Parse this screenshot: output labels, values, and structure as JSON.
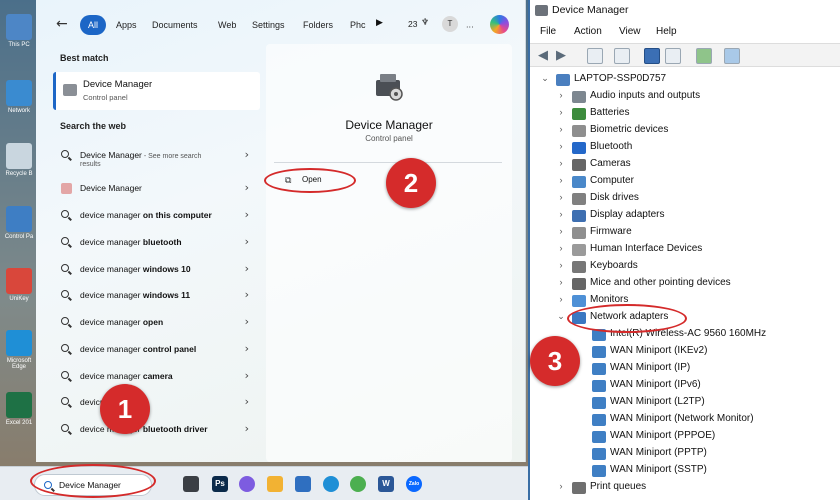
{
  "desktop": {
    "icons": [
      {
        "label": "This PC",
        "color": "#4d86c6"
      },
      {
        "label": "Network",
        "color": "#3a8bd0"
      },
      {
        "label": "Recycle B",
        "color": "#c9d6df"
      },
      {
        "label": "Control Pa",
        "color": "#3e7ec4"
      },
      {
        "label": "UniKey",
        "color": "#d9473b"
      },
      {
        "label": "Microsoft Edge",
        "color": "#1f8fd6"
      },
      {
        "label": "Excel 201",
        "color": "#1e7145"
      }
    ]
  },
  "start": {
    "filters": [
      "All",
      "Apps",
      "Documents",
      "Web",
      "Settings",
      "Folders",
      "Phc"
    ],
    "play_icon": "play-icon",
    "points": "23",
    "user_initial": "T",
    "best_match_header": "Best match",
    "best_match": {
      "title": "Device Manager",
      "subtitle": "Control panel"
    },
    "search_web_header": "Search the web",
    "web_results": [
      {
        "label": "Device Manager",
        "suffix": " - See more search",
        "sub": "results",
        "icon": "search-icon"
      },
      {
        "label": "Device Manager",
        "suffix": "",
        "sub": "",
        "icon": "app-icon"
      },
      {
        "label": "device manager ",
        "bold": "on this computer",
        "icon": "search-icon"
      },
      {
        "label": "device manager ",
        "bold": "bluetooth",
        "icon": "search-icon"
      },
      {
        "label": "device manager ",
        "bold": "windows 10",
        "icon": "search-icon"
      },
      {
        "label": "device manager ",
        "bold": "windows 11",
        "icon": "search-icon"
      },
      {
        "label": "device manager ",
        "bold": "open",
        "icon": "search-icon"
      },
      {
        "label": "device manager ",
        "bold": "control panel",
        "icon": "search-icon"
      },
      {
        "label": "device manager ",
        "bold": "camera",
        "icon": "search-icon"
      },
      {
        "label": "devic",
        "bold": "md",
        "icon": "search-icon"
      },
      {
        "label": "device manager ",
        "bold": "bluetooth driver",
        "icon": "search-icon"
      }
    ],
    "preview": {
      "title": "Device Manager",
      "subtitle": "Control panel",
      "open_label": "Open"
    }
  },
  "taskbar": {
    "search_value": "Device Manager",
    "apps": [
      "taskview-icon",
      "photoshop-icon",
      "copilot-icon",
      "explorer-icon",
      "notepad-icon",
      "edge-icon",
      "chrome-icon",
      "word-icon",
      "zalo-icon"
    ],
    "ps_label": "Ps",
    "word_label": "W",
    "zalo_label": "Zalo"
  },
  "device_manager": {
    "title": "Device Manager",
    "menu": [
      "File",
      "Action",
      "View",
      "Help"
    ],
    "root": "LAPTOP-SSP0D757",
    "categories": [
      "Audio inputs and outputs",
      "Batteries",
      "Biometric devices",
      "Bluetooth",
      "Cameras",
      "Computer",
      "Disk drives",
      "Display adapters",
      "Firmware",
      "Human Interface Devices",
      "Keyboards",
      "Mice and other pointing devices",
      "Monitors",
      "Network adapters"
    ],
    "network_children": [
      "Intel(R) Wireless-AC 9560 160MHz",
      "WAN Miniport (IKEv2)",
      "WAN Miniport (IP)",
      "WAN Miniport (IPv6)",
      "WAN Miniport (L2TP)",
      "WAN Miniport (Network Monitor)",
      "WAN Miniport (PPPOE)",
      "WAN Miniport (PPTP)",
      "WAN Miniport (SSTP)"
    ],
    "after": "Print queues"
  },
  "annotations": [
    "1",
    "2",
    "3"
  ],
  "colors": {
    "accent": "#1c66c6",
    "annotation": "#d52b2b"
  }
}
